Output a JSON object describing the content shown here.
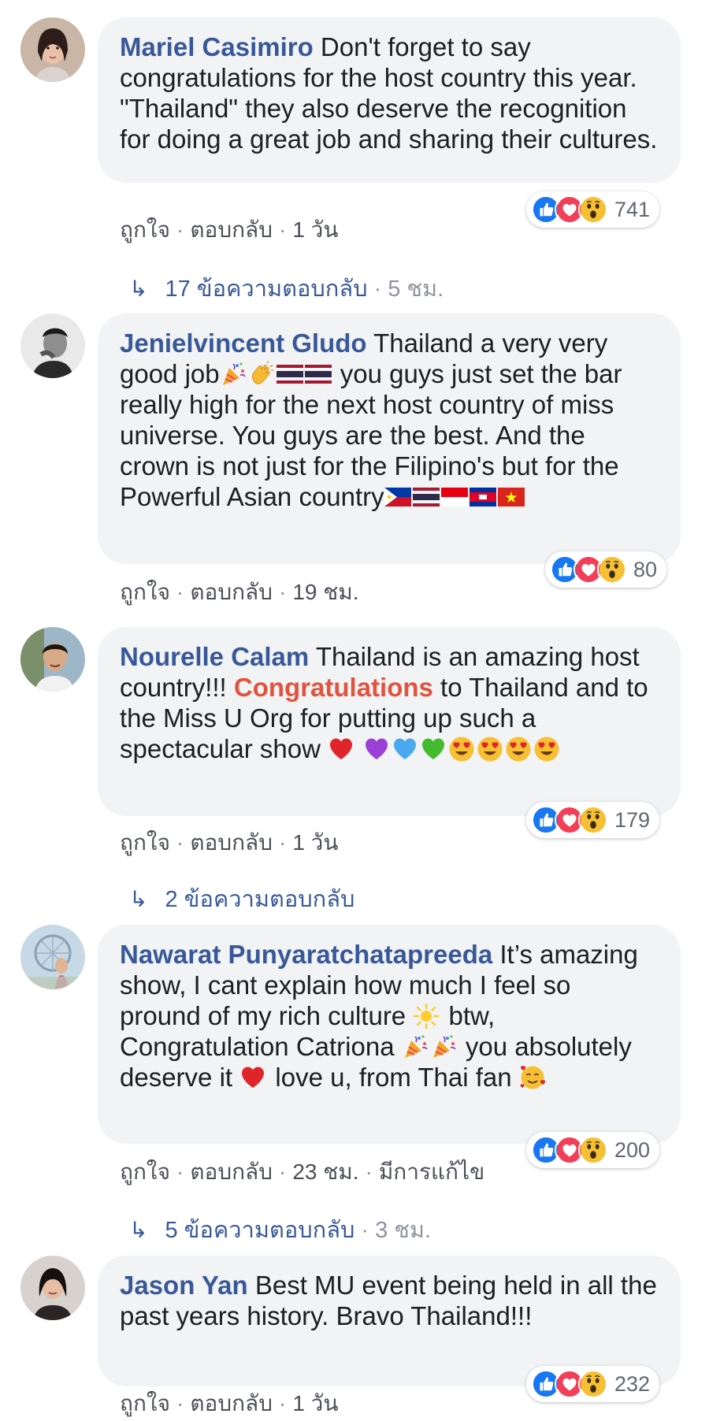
{
  "comments": [
    {
      "author": "Mariel Casimiro",
      "text": " Don't forget to say congratulations for the host country this year. \"Thailand\" they also deserve the recognition for doing a great job and sharing their cultures.",
      "reaction_count": "741",
      "like": "ถูกใจ",
      "reply": "ตอบกลับ",
      "time": "1 วัน",
      "replies_label": "17 ข้อความตอบกลับ",
      "replies_time": "5 ชม."
    },
    {
      "author": "Jenielvincent Gludo",
      "text_1": " Thailand a very very good job",
      "text_2": " you guys just set the bar really high for the next host country of miss universe. You guys are the best. And the crown is not just for the Filipino's but for the Powerful Asian country",
      "reaction_count": "80",
      "like": "ถูกใจ",
      "reply": "ตอบกลับ",
      "time": "19 ชม."
    },
    {
      "author": "Nourelle Calam",
      "text_1": " Thailand is an amazing host country!!! ",
      "highlight": "Congratulations",
      "text_2": " to Thailand and to the Miss U Org for putting up such a spectacular show ",
      "reaction_count": "179",
      "like": "ถูกใจ",
      "reply": "ตอบกลับ",
      "time": "1 วัน",
      "replies_label": "2 ข้อความตอบกลับ"
    },
    {
      "author": "Nawarat Punyaratchatapreeda",
      "text_1": " It’s amazing show, I cant explain how much I feel so pround of my rich culture ",
      "text_2": " btw, Congratulation Catriona ",
      "text_3": " you absolutely deserve it ",
      "text_4": " love u, from Thai fan ",
      "reaction_count": "200",
      "like": "ถูกใจ",
      "reply": "ตอบกลับ",
      "time": "23 ชม.",
      "edited": "มีการแก้ไข",
      "replies_label": "5 ข้อความตอบกลับ",
      "replies_time": "3 ชม."
    },
    {
      "author": "Jason Yan",
      "text": " Best MU event being held in all the past years history. Bravo Thailand!!!",
      "reaction_count": "232",
      "like": "ถูกใจ",
      "reply": "ตอบกลับ",
      "time": "1 วัน"
    }
  ],
  "reply_arrow": "↳",
  "separator": "·",
  "colors": {
    "author": "#385898",
    "bubble": "#f2f3f5",
    "highlight": "#e2533e",
    "like_blue": "#1877f2",
    "love_red": "#f33e58",
    "wow_yellow": "#f7c034"
  }
}
